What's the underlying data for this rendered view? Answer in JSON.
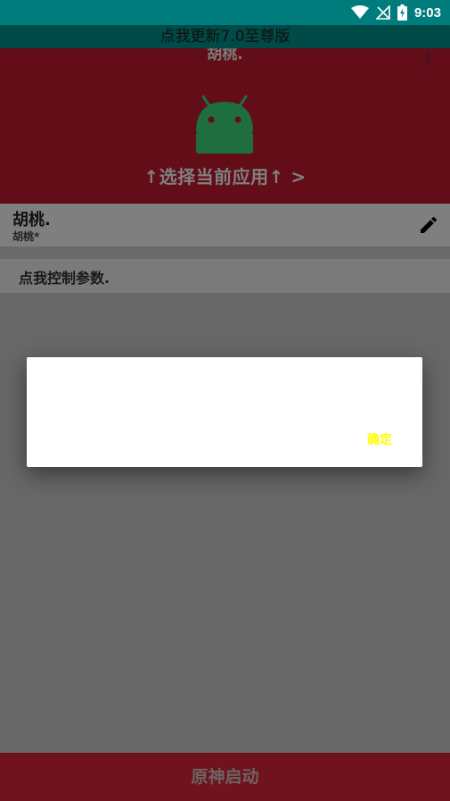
{
  "status_bar": {
    "time": "9:03",
    "icons": [
      "wifi-icon",
      "no-signal-icon",
      "battery-charging-icon"
    ]
  },
  "update_banner": {
    "text": "点我更新7.0至尊版"
  },
  "header": {
    "title": "胡桃.",
    "select_app_label": "↑选择当前应用↑ >",
    "logo": "android-logo-icon",
    "menu_icon": "more-vert-icon"
  },
  "app_card": {
    "name": "胡桃.",
    "subtitle": "胡桃*",
    "edit_icon": "edit-pencil-icon"
  },
  "control": {
    "label": "点我控制参数."
  },
  "bottom_bar": {
    "start_label": "原神启动"
  },
  "dialog": {
    "ok_label": "确定"
  },
  "colors": {
    "status_bar": "#007c7c",
    "banner": "#00958f",
    "header": "#c41b2e",
    "bottom_bar": "#e0273c",
    "dialog_button": "#ffff00",
    "android_green": "#3ddc84"
  }
}
